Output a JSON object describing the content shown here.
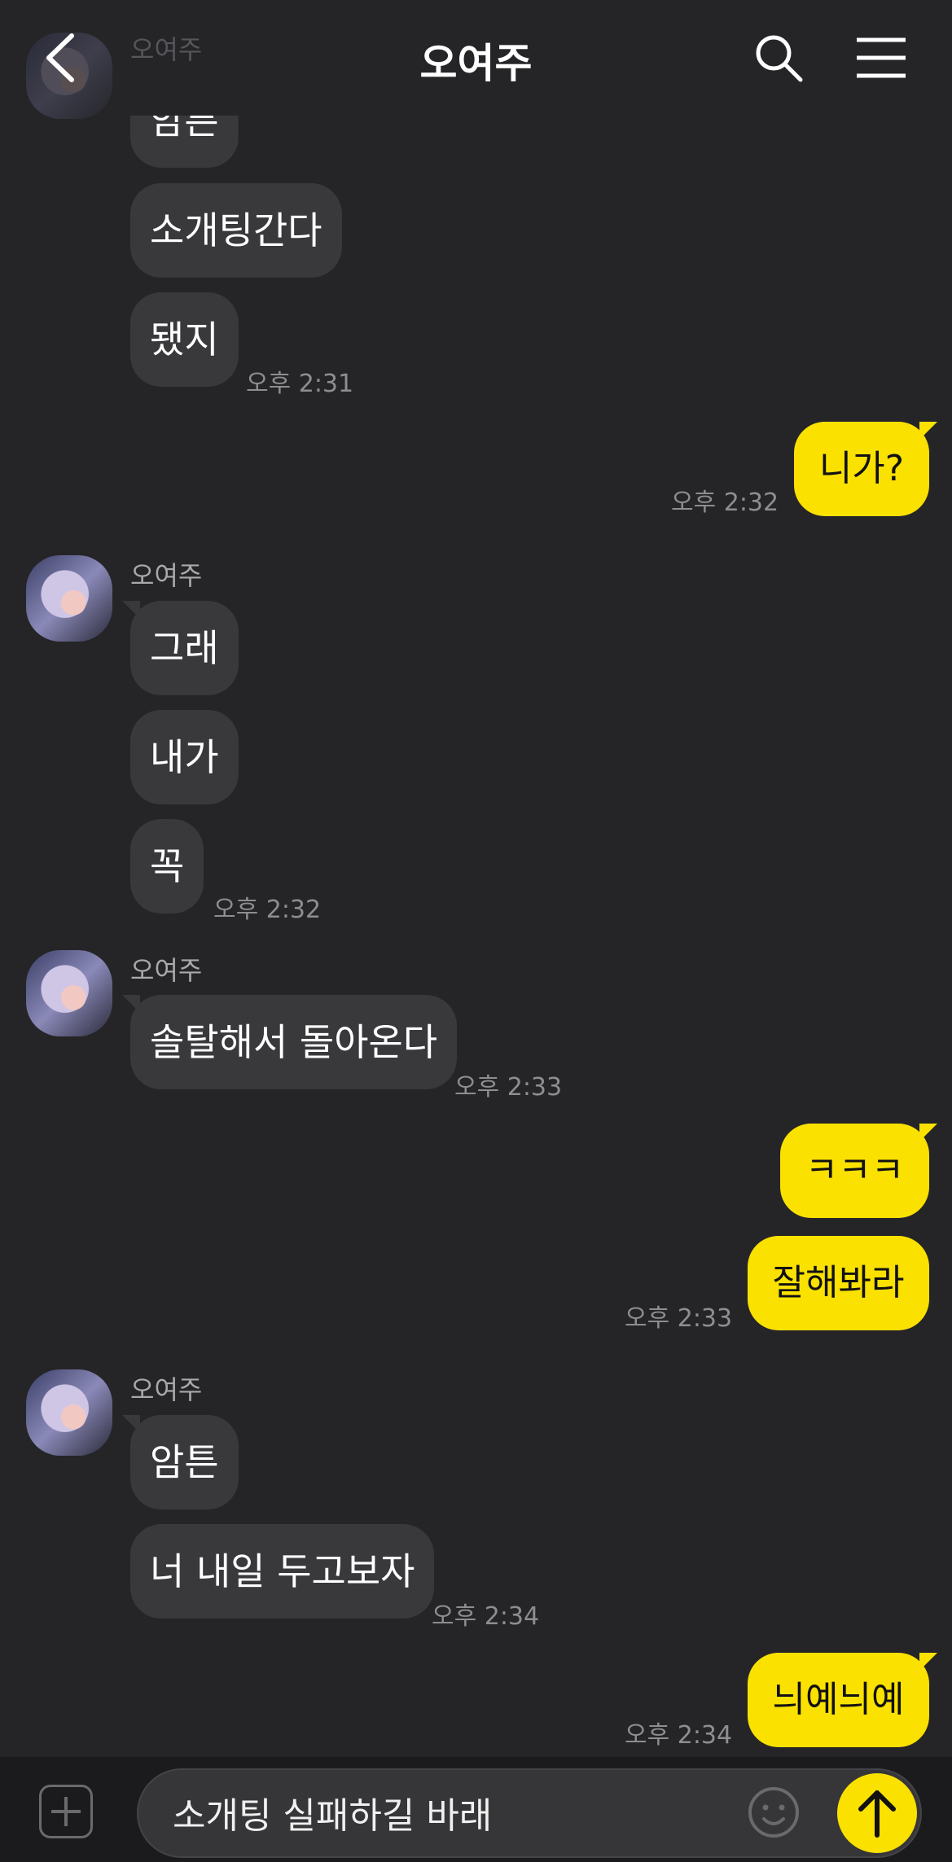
{
  "header": {
    "title": "오여주",
    "icons": [
      "back-arrow-icon",
      "search-icon",
      "menu-icon"
    ]
  },
  "messages": {
    "g0_sender": "오여주",
    "g0_m0": "암튼",
    "g0_m1": "소개팅간다",
    "g0_m2": "됐지",
    "g0_time": "오후 2:31",
    "me0_m0": "니가?",
    "me0_time": "오후 2:32",
    "g1_sender": "오여주",
    "g1_m0": "그래",
    "g1_m1": "내가",
    "g1_m2": "꼭",
    "g1_time": "오후 2:32",
    "g2_sender": "오여주",
    "g2_m0": "솔탈해서 돌아온다",
    "g2_time": "오후 2:33",
    "me1_m0": "ㅋㅋㅋ",
    "me1_m1": "잘해봐라",
    "me1_time": "오후 2:33",
    "g3_sender": "오여주",
    "g3_m0": "암튼",
    "g3_m1": "너 내일 두고보자",
    "g3_time": "오후 2:34",
    "me2_m0": "늬예늬예",
    "me2_time": "오후 2:34"
  },
  "input": {
    "value": "소개팅 실패하길 바래",
    "icons": [
      "plus-icon",
      "emoji-icon",
      "send-arrow-icon"
    ]
  },
  "colors": {
    "background": "#252528",
    "my_bubble": "#fae100",
    "other_bubble": "#39393c"
  }
}
